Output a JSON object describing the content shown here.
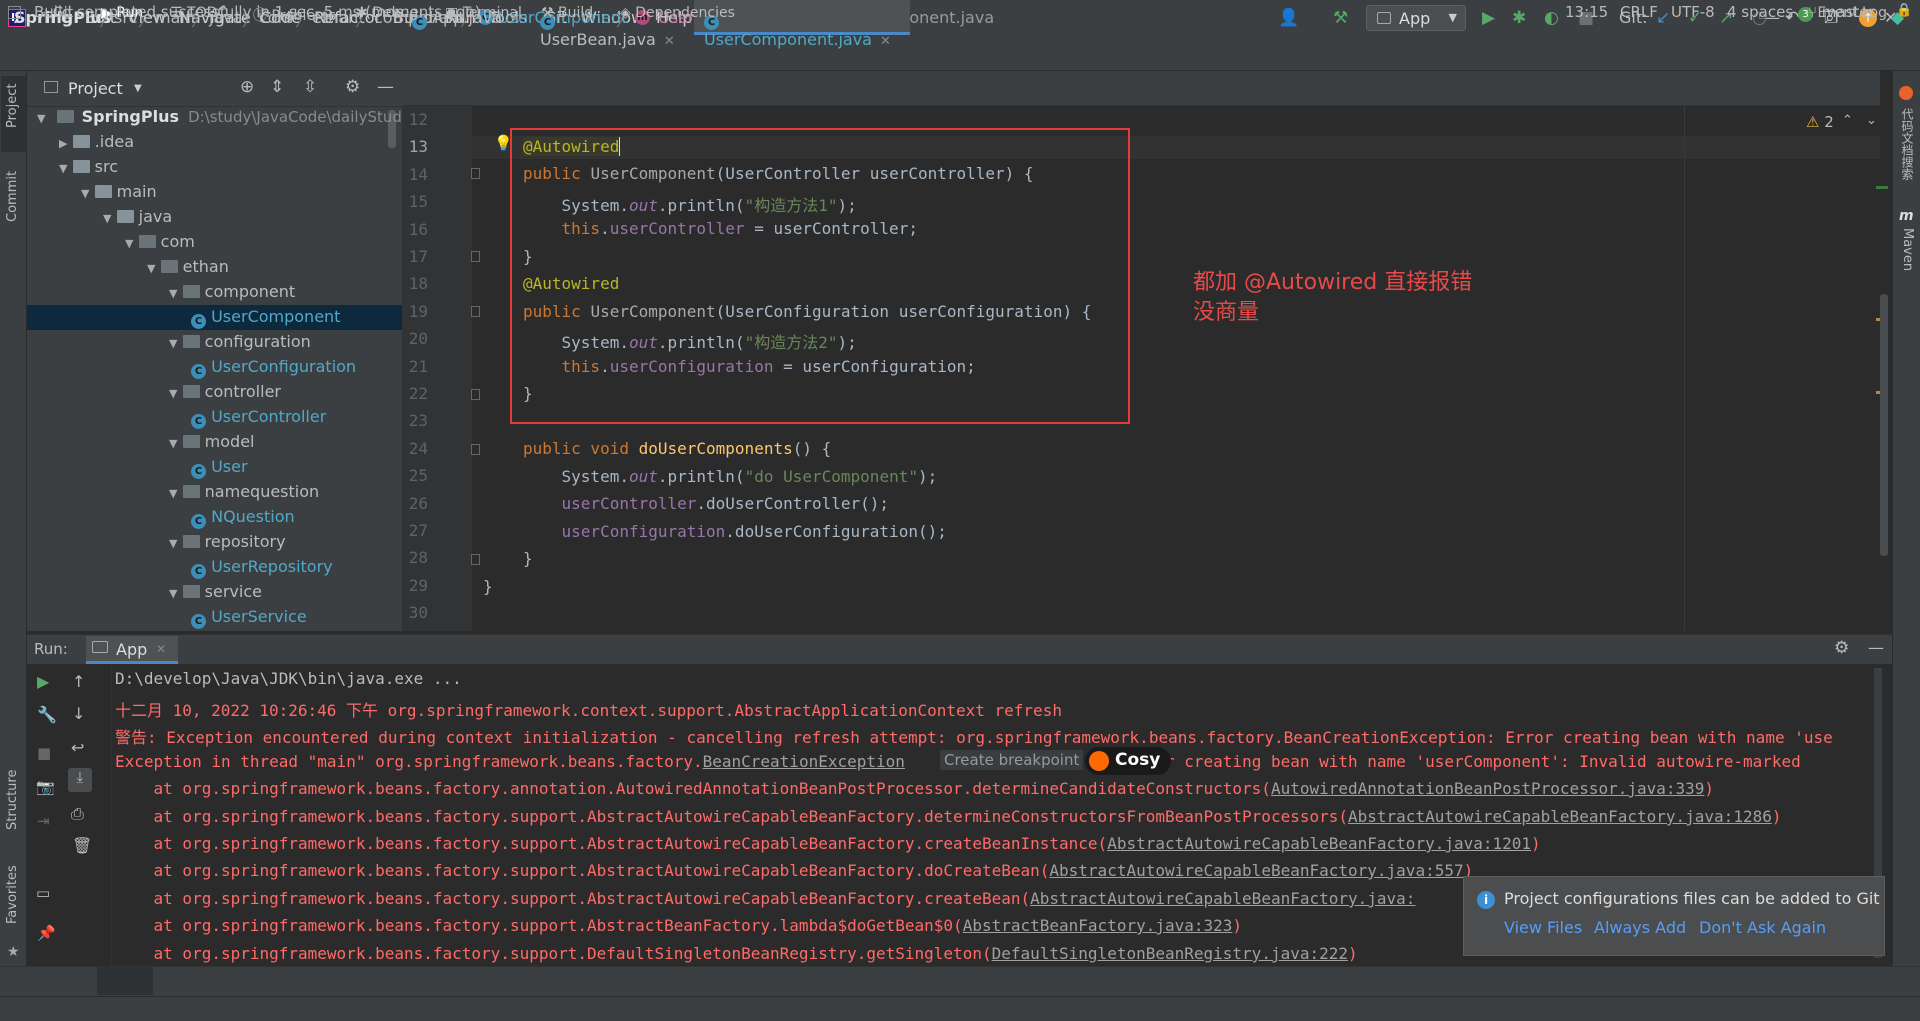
{
  "window": {
    "title": "SpringPlus - UserComponent.java",
    "menu": [
      "File",
      "Edit",
      "View",
      "Navigate",
      "Code",
      "Refactor",
      "Build",
      "Run",
      "Tools",
      "Git",
      "Window",
      "Help"
    ]
  },
  "navbar": {
    "crumbs": [
      "SpringPlus",
      "src",
      "main",
      "java",
      "com",
      "ethan",
      "component"
    ],
    "class_crumb": "UserComponent",
    "method_crumb": "UserComponent",
    "run_config": "App",
    "git_label": "Git:"
  },
  "left_strip": {
    "project": "Project",
    "commit": "Commit",
    "structure": "Structure",
    "favorites": "Favorites"
  },
  "right_strip": {
    "code_search": "代码文档搜索",
    "maven": "Maven"
  },
  "project": {
    "title": "Project",
    "root_name": "SpringPlus",
    "root_path": "D:\\study\\JavaCode\\dailyStudy\\S",
    "tree": [
      {
        "label": ".idea",
        "level": 1,
        "kind": "folder",
        "expanded": false
      },
      {
        "label": "src",
        "level": 1,
        "kind": "folder",
        "expanded": true
      },
      {
        "label": "main",
        "level": 2,
        "kind": "folder",
        "expanded": true
      },
      {
        "label": "java",
        "level": 3,
        "kind": "folder",
        "expanded": true
      },
      {
        "label": "com",
        "level": 4,
        "kind": "pkg",
        "expanded": true
      },
      {
        "label": "ethan",
        "level": 5,
        "kind": "pkg",
        "expanded": true
      },
      {
        "label": "component",
        "level": 6,
        "kind": "pkg",
        "expanded": true
      },
      {
        "label": "UserComponent",
        "level": 7,
        "kind": "class",
        "selected": true
      },
      {
        "label": "configuration",
        "level": 6,
        "kind": "pkg",
        "expanded": true
      },
      {
        "label": "UserConfiguration",
        "level": 7,
        "kind": "class"
      },
      {
        "label": "controller",
        "level": 6,
        "kind": "pkg",
        "expanded": true
      },
      {
        "label": "UserController",
        "level": 7,
        "kind": "class"
      },
      {
        "label": "model",
        "level": 6,
        "kind": "pkg",
        "expanded": true
      },
      {
        "label": "User",
        "level": 7,
        "kind": "class"
      },
      {
        "label": "namequestion",
        "level": 6,
        "kind": "pkg",
        "expanded": true
      },
      {
        "label": "NQuestion",
        "level": 7,
        "kind": "class"
      },
      {
        "label": "repository",
        "level": 6,
        "kind": "pkg",
        "expanded": true
      },
      {
        "label": "UserRepository",
        "level": 7,
        "kind": "class"
      },
      {
        "label": "service",
        "level": 6,
        "kind": "pkg",
        "expanded": true
      },
      {
        "label": "UserService",
        "level": 7,
        "kind": "class"
      }
    ]
  },
  "tabs": [
    {
      "label": "App.java",
      "active": false
    },
    {
      "label": "UserBean.java",
      "active": false
    },
    {
      "label": "UserComponent.java",
      "active": true
    }
  ],
  "editor": {
    "warning_count": "2",
    "line_numbers": [
      "12",
      "13",
      "14",
      "15",
      "16",
      "17",
      "18",
      "19",
      "20",
      "21",
      "22",
      "23",
      "24",
      "25",
      "26",
      "27",
      "28",
      "29",
      "30"
    ],
    "annotation_line1": "都加 @Autowired 直接报错",
    "annotation_line2": "没商量",
    "code": {
      "l13_ann": "@Autowired",
      "l14_kw": "public ",
      "l14_name": "UserComponent",
      "l14_rest": "(UserController userController) {",
      "l15_a": "    System.",
      "l15_out": "out",
      "l15_b": ".println(",
      "l15_str": "\"构造方法1\"",
      "l15_c": ");",
      "l16_kw": "    this",
      "l16_a": ".",
      "l16_fd": "userController",
      "l16_b": " = userController;",
      "l17": "}",
      "l18_ann": "@Autowired",
      "l19_kw": "public ",
      "l19_name": "UserComponent",
      "l19_rest": "(UserConfiguration userConfiguration) {",
      "l20_a": "    System.",
      "l20_out": "out",
      "l20_b": ".println(",
      "l20_str": "\"构造方法2\"",
      "l20_c": ");",
      "l21_kw": "    this",
      "l21_a": ".",
      "l21_fd": "userConfiguration",
      "l21_b": " = userConfiguration;",
      "l22": "}",
      "l24_kw": "public void ",
      "l24_fn": "doUserComponents",
      "l24_rest": "() {",
      "l25_a": "    System.",
      "l25_out": "out",
      "l25_b": ".println(",
      "l25_str": "\"do UserComponent\"",
      "l25_c": ");",
      "l26_fd": "    userController",
      "l26_b": ".doUserController();",
      "l27_fd": "    userConfiguration",
      "l27_b": ".doUserConfiguration();",
      "l28": "}",
      "l29": "}"
    }
  },
  "run": {
    "label": "Run:",
    "tab": "App",
    "console": {
      "cmd": "D:\\develop\\Java\\JDK\\bin\\java.exe ...",
      "log1": "十二月 10, 2022 10:26:46 下午 org.springframework.context.support.AbstractApplicationContext refresh",
      "log2": "警告: Exception encountered during context initialization - cancelling refresh attempt: org.springframework.beans.factory.BeanCreationException: Error creating bean with name 'use",
      "log3_a": "Exception in thread \"main\" org.springframework.beans.factory.",
      "log3_link": "BeanCreationException",
      "log3_b": ": Error creating bean with name 'userComponent': Invalid autowire-marked",
      "st1_a": "    at org.springframework.beans.factory.annotation.AutowiredAnnotationBeanPostProcessor.determineCandidateConstructors(",
      "st1_link": "AutowiredAnnotationBeanPostProcessor.java:339",
      "st1_b": ")",
      "st2_a": "    at org.springframework.beans.factory.support.AbstractAutowireCapableBeanFactory.determineConstructorsFromBeanPostProcessors(",
      "st2_link": "AbstractAutowireCapableBeanFactory.java:1286",
      "st2_b": ")",
      "st3_a": "    at org.springframework.beans.factory.support.AbstractAutowireCapableBeanFactory.createBeanInstance(",
      "st3_link": "AbstractAutowireCapableBeanFactory.java:1201",
      "st3_b": ")",
      "st4_a": "    at org.springframework.beans.factory.support.AbstractAutowireCapableBeanFactory.doCreateBean(",
      "st4_link": "AbstractAutowireCapableBeanFactory.java:557",
      "st4_b": ")",
      "st5_a": "    at org.springframework.beans.factory.support.AbstractAutowireCapableBeanFactory.createBean(",
      "st5_link": "AbstractAutowireCapableBeanFactory.java:",
      "st6_a": "    at org.springframework.beans.factory.support.AbstractBeanFactory.lambda$doGetBean$0(",
      "st6_link": "AbstractBeanFactory.java:323",
      "st6_b": ")",
      "st7_a": "    at org.springframework.beans.factory.support.DefaultSingletonBeanRegistry.getSingleton(",
      "st7_link": "DefaultSingletonBeanRegistry.java:222",
      "st7_b": ")"
    },
    "hover_tip": "Create breakpoint",
    "cosy": "Cosy"
  },
  "notification": {
    "text": "Project configurations files can be added to Git",
    "actions": [
      "View Files",
      "Always Add",
      "Don't Ask Again"
    ]
  },
  "tool_windows": [
    {
      "label": "Git",
      "icon": "git-branch-icon"
    },
    {
      "label": "Run",
      "icon": "play-icon",
      "active": true
    },
    {
      "label": "TODO",
      "icon": "list-icon"
    },
    {
      "label": "Problems",
      "icon": "info-icon"
    },
    {
      "label": "Debug",
      "icon": "bug-icon"
    },
    {
      "label": "Terminal",
      "icon": "terminal-icon"
    },
    {
      "label": "Build",
      "icon": "hammer-icon"
    },
    {
      "label": "Dependencies",
      "icon": "layers-icon"
    }
  ],
  "event_log": {
    "count": "3",
    "label": "Event Log"
  },
  "status": {
    "message": "Build completed successfully in 1 sec, 5 ms (moments ago)",
    "position": "13:15",
    "line_sep": "CRLF",
    "encoding": "UTF-8",
    "indent": "4 spaces",
    "branch": "master"
  },
  "colors": {
    "accent": "#4a88c7",
    "error": "#ff6b68",
    "annotation_red": "#e33a3a",
    "keyword": "#cc7832",
    "string": "#6a8759"
  }
}
